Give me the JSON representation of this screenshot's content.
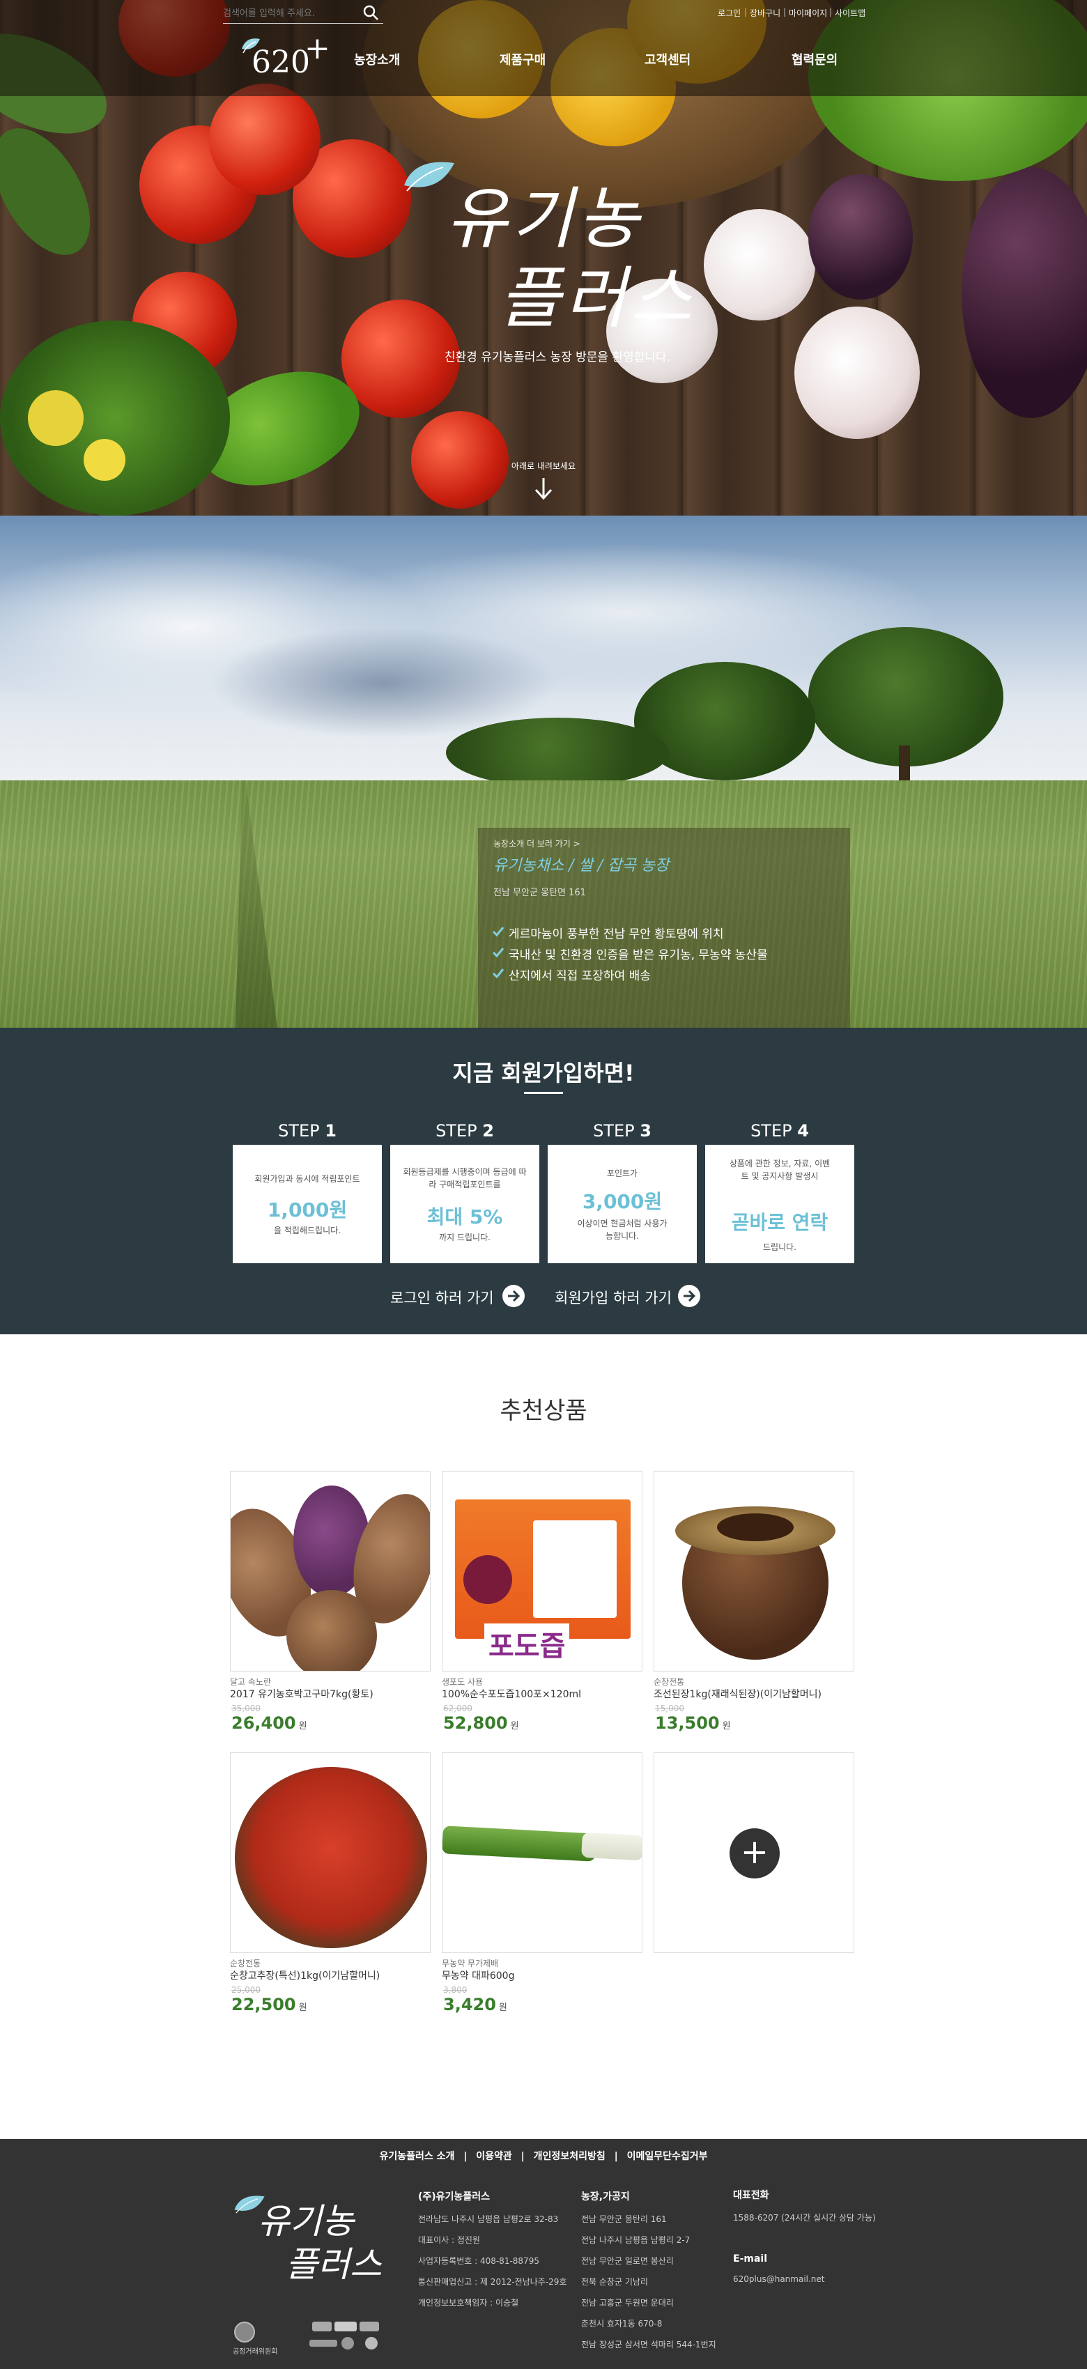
{
  "header": {
    "search_placeholder": "검색어를 입력해 주세요.",
    "util_links": [
      "로그인",
      "장바구니",
      "마이페이지",
      "사이트맵"
    ],
    "logo_text": "620",
    "logo_plus": "+",
    "nav": [
      "농장소개",
      "제품구매",
      "고객센터",
      "협력문의"
    ]
  },
  "hero": {
    "brand_line1": "유기농",
    "brand_line2": "플러스",
    "subtitle": "친환경 유기농플러스 농장 방문을 환영합니다.",
    "scroll_hint": "아래로 내려보세요"
  },
  "farm": {
    "link": "농장소개 더 보러 가기 >",
    "title": "유기농채소 / 쌀 / 잡곡 농장",
    "address": "전남 무안군 몽탄면 161",
    "bullets": [
      "게르마늄이 풍부한 전남 무안 황토땅에 위치",
      "국내산 및 친환경 인증을 받은 유기농, 무농약 농산물",
      "산지에서 직접 포장하여 배송"
    ]
  },
  "signup": {
    "heading": "지금 회원가입하면!",
    "steps": [
      {
        "label": "STEP",
        "num": "1",
        "top": "회원가입과 동시에 적립포인트",
        "big": "1,000원",
        "bottom": "을 적립해드립니다."
      },
      {
        "label": "STEP",
        "num": "2",
        "top": "회원등급제를 시행중이며 등급에 따라 구매적립포인트를",
        "big": "최대 5%",
        "bottom": "까지 드립니다."
      },
      {
        "label": "STEP",
        "num": "3",
        "top": "포인트가",
        "big": "3,000원",
        "bottom": "이상이면 현금처럼 사용가능합니다."
      },
      {
        "label": "STEP",
        "num": "4",
        "top": "상품에 관한 정보, 자료, 이벤트 및 공지사항 발생시",
        "big": "곧바로 연락",
        "bottom": "드립니다."
      }
    ],
    "login_link": "로그인 하러 가기",
    "join_link": "회원가입 하러 가기"
  },
  "products": {
    "heading": "추천상품",
    "items": [
      {
        "category": "달고 속노란",
        "name": "2017 유기농호박고구마7kg(황토)",
        "old_price": "35,000",
        "price": "26,400",
        "won": "원"
      },
      {
        "category": "생포도 사용",
        "name": "100%순수포도즙100포×120ml",
        "old_price": "62,000",
        "price": "52,800",
        "won": "원",
        "box_text": "포도즙"
      },
      {
        "category": "순창전통",
        "name": "조선된장1kg(재래식된장)(이기남할머니)",
        "old_price": "15,000",
        "price": "13,500",
        "won": "원"
      },
      {
        "category": "순창전통",
        "name": "순창고추장(특선)1kg(이기남할머니)",
        "old_price": "25,000",
        "price": "22,500",
        "won": "원"
      },
      {
        "category": "무농약 무가제배",
        "name": "무농약 대파600g",
        "old_price": "3,800",
        "price": "3,420",
        "won": "원"
      }
    ],
    "more_symbol": "+"
  },
  "footer": {
    "links": [
      "유기농플러스 소개",
      "이용약관",
      "개인정보처리방침",
      "이메일무단수집거부"
    ],
    "company_head": "(주)유기농플러스",
    "company_lines": [
      "전라남도 나주시 남평읍 남평2로 32-83",
      "대표이사 : 정진원",
      "사업자등록번호 : 408-81-88795",
      "통신판매업신고 : 제 2012-전남나주-29호",
      "개인정보보호책임자 : 이승철"
    ],
    "farm_head": "농장,가공지",
    "farm_lines": [
      "전남 무안군 몽탄리 161",
      "전남 나주시 남평읍 남평리 2-7",
      "전남 무안군 일로면 봉산리",
      "전북 순창군 기남리",
      "전남 고흥군 두원면 운대리",
      "춘천시 효자1동 670-8",
      "전남 장성군 삼서면 석마리 544-1번지"
    ],
    "phone_head": "대표전화",
    "phone": "1588-6207 (24시간 실시간 상담 가능)",
    "email_head": "E-mail",
    "email": "620plus@hanmail.net",
    "logo_line1": "유기농",
    "logo_line2": "플러스",
    "badge_text": "공정거래위원회"
  },
  "colors": {
    "signup_bg": "#2b3b41",
    "accent_blue": "#6cc0d6",
    "price_green": "#3a7d2c",
    "footer_bg": "#333333"
  }
}
